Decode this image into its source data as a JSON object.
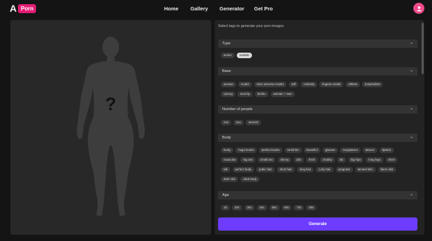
{
  "logo": {
    "letter": "A",
    "badge": "Porn"
  },
  "nav": [
    {
      "label": "Home"
    },
    {
      "label": "Gallery"
    },
    {
      "label": "Generator"
    },
    {
      "label": "Get Pro"
    }
  ],
  "preview": {
    "question": "?"
  },
  "panel": {
    "intro": "Select tags to generate your porn images",
    "sections": [
      {
        "title": "Type",
        "toggle": "⌄",
        "rows": [
          [
            {
              "label": "anime"
            },
            {
              "label": "realistic",
              "selected": true
            }
          ]
        ]
      },
      {
        "title": "Base",
        "toggle": "⌄",
        "rows": [
          [
            {
              "label": "woman"
            },
            {
              "label": "model"
            },
            {
              "label": "miss universe model"
            },
            {
              "label": "milf"
            },
            {
              "label": "celebrity"
            },
            {
              "label": "lingerie model"
            },
            {
              "label": "athlete"
            },
            {
              "label": "bodybuilder"
            }
          ],
          [
            {
              "label": "cyborg"
            },
            {
              "label": "sorority"
            },
            {
              "label": "bimbo"
            },
            {
              "label": "woman + man"
            }
          ]
        ]
      },
      {
        "title": "Number of people",
        "toggle": "⌄",
        "rows": [
          [
            {
              "label": "one"
            },
            {
              "label": "two"
            },
            {
              "label": "several"
            }
          ]
        ]
      },
      {
        "title": "Body",
        "toggle": "⌄",
        "rows": [
          [
            {
              "label": "busty"
            },
            {
              "label": "huge boobs"
            },
            {
              "label": "perfect boobs"
            },
            {
              "label": "small tits"
            },
            {
              "label": "beautiful"
            },
            {
              "label": "glasses"
            },
            {
              "label": "sunglasses"
            },
            {
              "label": "tattoos"
            },
            {
              "label": "lipstick"
            }
          ],
          [
            {
              "label": "muscular"
            },
            {
              "label": "big ass"
            },
            {
              "label": "small ass"
            },
            {
              "label": "skinny"
            },
            {
              "label": "abs"
            },
            {
              "label": "thick"
            },
            {
              "label": "chubby"
            },
            {
              "label": "fat"
            },
            {
              "label": "big hips"
            },
            {
              "label": "long legs"
            },
            {
              "label": "short"
            }
          ],
          [
            {
              "label": "tall"
            },
            {
              "label": "perfect body"
            },
            {
              "label": "pubic hair"
            },
            {
              "label": "short hair"
            },
            {
              "label": "long hair"
            },
            {
              "label": "curly hair"
            },
            {
              "label": "pregnant"
            },
            {
              "label": "tanned skin"
            },
            {
              "label": "fairer skin"
            }
          ],
          [
            {
              "label": "dark skin"
            },
            {
              "label": "oiled body"
            }
          ]
        ]
      },
      {
        "title": "Age",
        "toggle": "⌄",
        "rows": [
          [
            {
              "label": "18"
            },
            {
              "label": "20s"
            },
            {
              "label": "30s"
            },
            {
              "label": "40s"
            },
            {
              "label": "50s"
            },
            {
              "label": "60s"
            },
            {
              "label": "70s"
            },
            {
              "label": "80s"
            }
          ]
        ]
      }
    ],
    "generate_label": "Generate"
  },
  "colors": {
    "accent": "#6d3cff",
    "brand": "#e11d74",
    "profile": "#f04a8b"
  }
}
